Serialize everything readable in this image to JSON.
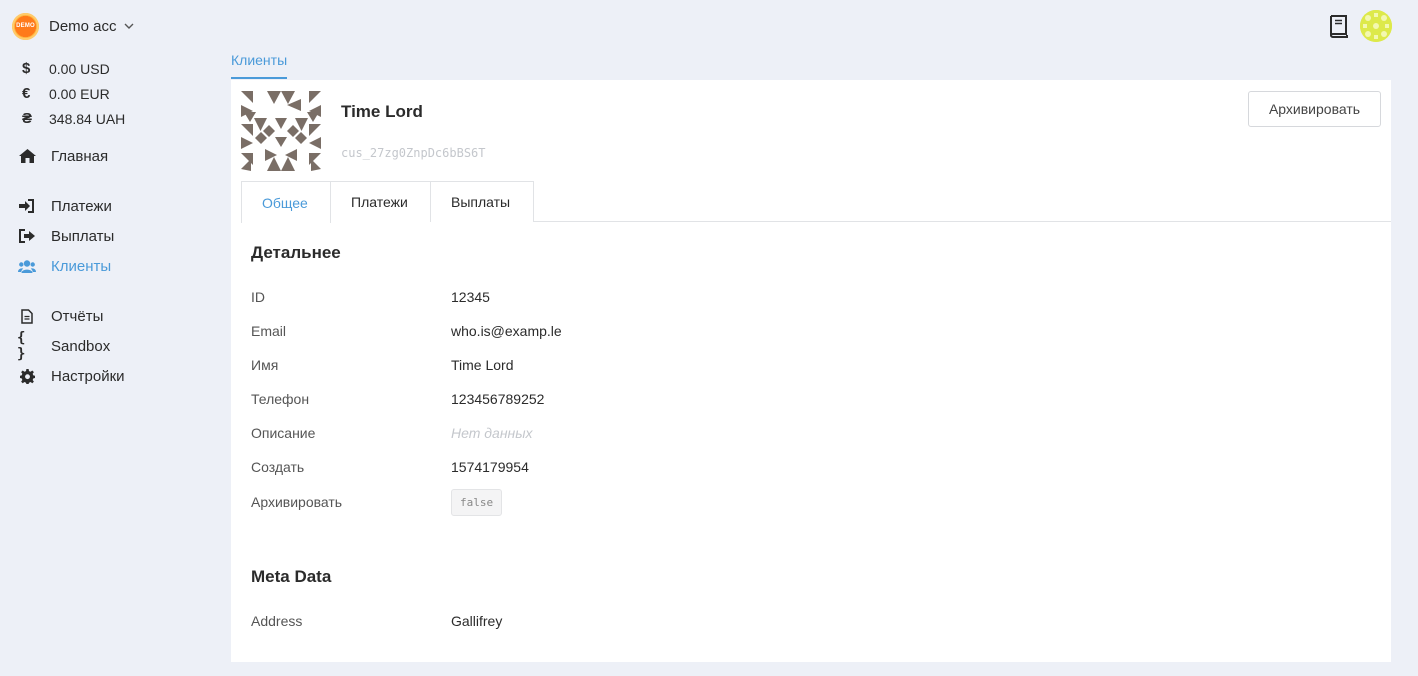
{
  "account": {
    "logo_text": "DEMO",
    "name": "Demo acc",
    "chevron_icon": "chevron-down-icon"
  },
  "balances": [
    {
      "symbol": "$",
      "amount": "0.00 USD"
    },
    {
      "symbol": "€",
      "amount": "0.00 EUR"
    },
    {
      "symbol": "₴",
      "amount": "348.84 UAH"
    }
  ],
  "nav": {
    "home": {
      "label": "Главная",
      "icon": "home-icon"
    },
    "payments": {
      "label": "Платежи",
      "icon": "sign-in-icon"
    },
    "payouts": {
      "label": "Выплаты",
      "icon": "sign-out-icon"
    },
    "customers": {
      "label": "Клиенты",
      "icon": "users-icon",
      "active": true
    },
    "reports": {
      "label": "Отчёты",
      "icon": "file-icon"
    },
    "sandbox": {
      "label": "Sandbox",
      "icon": "braces-icon"
    },
    "settings": {
      "label": "Настройки",
      "icon": "gear-icon"
    }
  },
  "top": {
    "docs_icon": "book-icon",
    "avatar_icon": "avatar-icon"
  },
  "breadcrumb": {
    "label": "Клиенты"
  },
  "customer": {
    "name": "Time Lord",
    "id": "cus_27zg0ZnpDc6bBS6T",
    "archive_button": "Архивировать"
  },
  "tabs": [
    {
      "label": "Общее",
      "active": true
    },
    {
      "label": "Платежи",
      "active": false
    },
    {
      "label": "Выплаты",
      "active": false
    }
  ],
  "details": {
    "title": "Детальнее",
    "rows": [
      {
        "key": "ID",
        "value": "12345"
      },
      {
        "key": "Email",
        "value": "who.is@examp.le"
      },
      {
        "key": "Имя",
        "value": "Time Lord"
      },
      {
        "key": "Телефон",
        "value": "123456789252"
      },
      {
        "key": "Описание",
        "value": "Нет данных"
      },
      {
        "key": "Создать",
        "value": "1574179954"
      },
      {
        "key": "Архивировать",
        "value": "false"
      }
    ]
  },
  "meta": {
    "title": "Meta Data",
    "rows": [
      {
        "key": "Address",
        "value": "Gallifrey"
      }
    ]
  },
  "colors": {
    "accent": "#4a9ad9",
    "background": "#edf0f7",
    "identicon": "#7a6e66"
  }
}
